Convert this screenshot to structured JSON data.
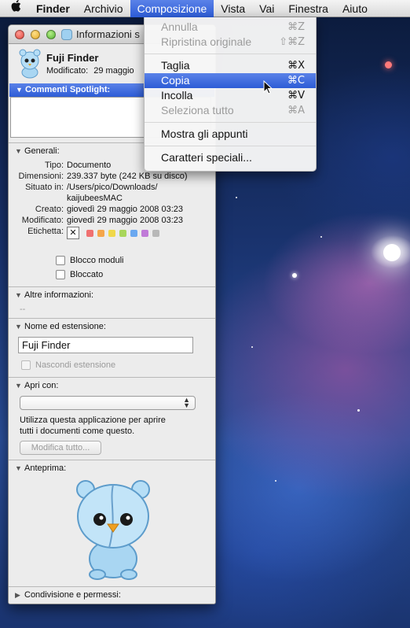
{
  "menubar": {
    "apple": "",
    "items": [
      "Finder",
      "Archivio",
      "Composizione",
      "Vista",
      "Vai",
      "Finestra",
      "Aiuto"
    ]
  },
  "edit_menu": {
    "items": [
      {
        "label": "Annulla",
        "shortcut": "⌘Z",
        "state": "disabled"
      },
      {
        "label": "Ripristina originale",
        "shortcut": "⇧⌘Z",
        "state": "disabled"
      },
      {
        "label": "Taglia",
        "shortcut": "⌘X",
        "state": "enabled"
      },
      {
        "label": "Copia",
        "shortcut": "⌘C",
        "state": "highlighted"
      },
      {
        "label": "Incolla",
        "shortcut": "⌘V",
        "state": "enabled"
      },
      {
        "label": "Seleziona tutto",
        "shortcut": "⌘A",
        "state": "disabled"
      },
      {
        "label": "Mostra gli appunti",
        "shortcut": "",
        "state": "enabled"
      },
      {
        "label": "Caratteri speciali...",
        "shortcut": "",
        "state": "enabled"
      }
    ]
  },
  "info_window": {
    "title": "Informazioni s",
    "file_name": "Fuji Finder",
    "modified_label": "Modificato:",
    "modified_value": "29 maggio",
    "spotlight_header": "Commenti Spotlight:",
    "general": {
      "header": "Generali:",
      "rows": [
        {
          "k": "Tipo:",
          "v": "Documento"
        },
        {
          "k": "Dimensioni:",
          "v": "239.337 byte (242 KB su disco)"
        },
        {
          "k": "Situato in:",
          "v": "/Users/pico/Downloads/"
        },
        {
          "k": "",
          "v": "kaijubeesMAC"
        },
        {
          "k": "Creato:",
          "v": "giovedì 29 maggio 2008 03:23"
        },
        {
          "k": "Modificato:",
          "v": "giovedì 29 maggio 2008 03:23"
        }
      ],
      "label_key": "Etichetta:",
      "label_x": "✕",
      "label_colors": [
        "#f07070",
        "#f5a64a",
        "#f0d84a",
        "#a9d65a",
        "#6aa8f0",
        "#c07ad8",
        "#b8b8b8"
      ],
      "lock_stationery": "Blocco moduli",
      "locked": "Bloccato"
    },
    "more_info": {
      "header": "Altre informazioni:",
      "value": "--"
    },
    "name_ext": {
      "header": "Nome ed estensione:",
      "value": "Fuji Finder",
      "hide_ext": "Nascondi estensione"
    },
    "open_with": {
      "header": "Apri con:",
      "description_line1": "Utilizza questa applicazione per aprire",
      "description_line2": "tutti i documenti come questo.",
      "change_all": "Modifica tutto..."
    },
    "preview": {
      "header": "Anteprima:"
    },
    "sharing": {
      "header": "Condivisione e permessi:"
    }
  }
}
